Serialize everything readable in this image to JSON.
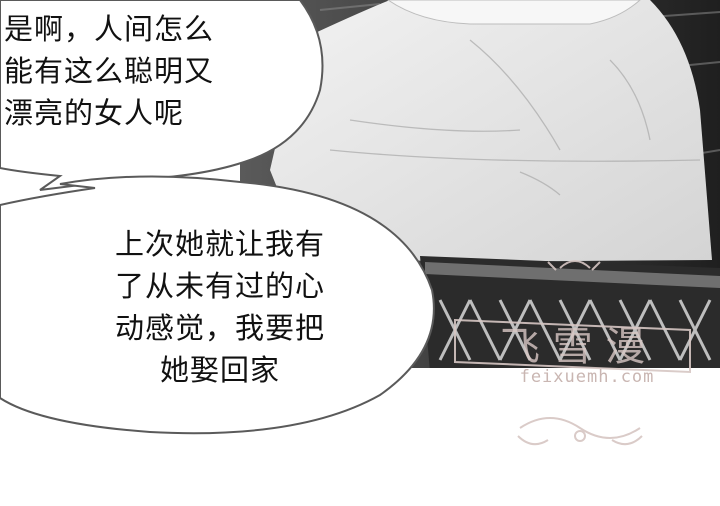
{
  "bubbles": {
    "top": {
      "lines": [
        "是啊，人间怎么",
        "能有这么聪明又",
        "漂亮的女人呢"
      ]
    },
    "bottom": {
      "lines": [
        "上次她就让我有",
        "了从未有过的心",
        "动感觉，我要把",
        "她娶回家"
      ]
    }
  },
  "watermark": {
    "text": "feixuemh.com"
  },
  "colors": {
    "shirt": "#e6e6e6",
    "background_dark": "#2a2a2a",
    "watermark": "#c9b6b2"
  }
}
